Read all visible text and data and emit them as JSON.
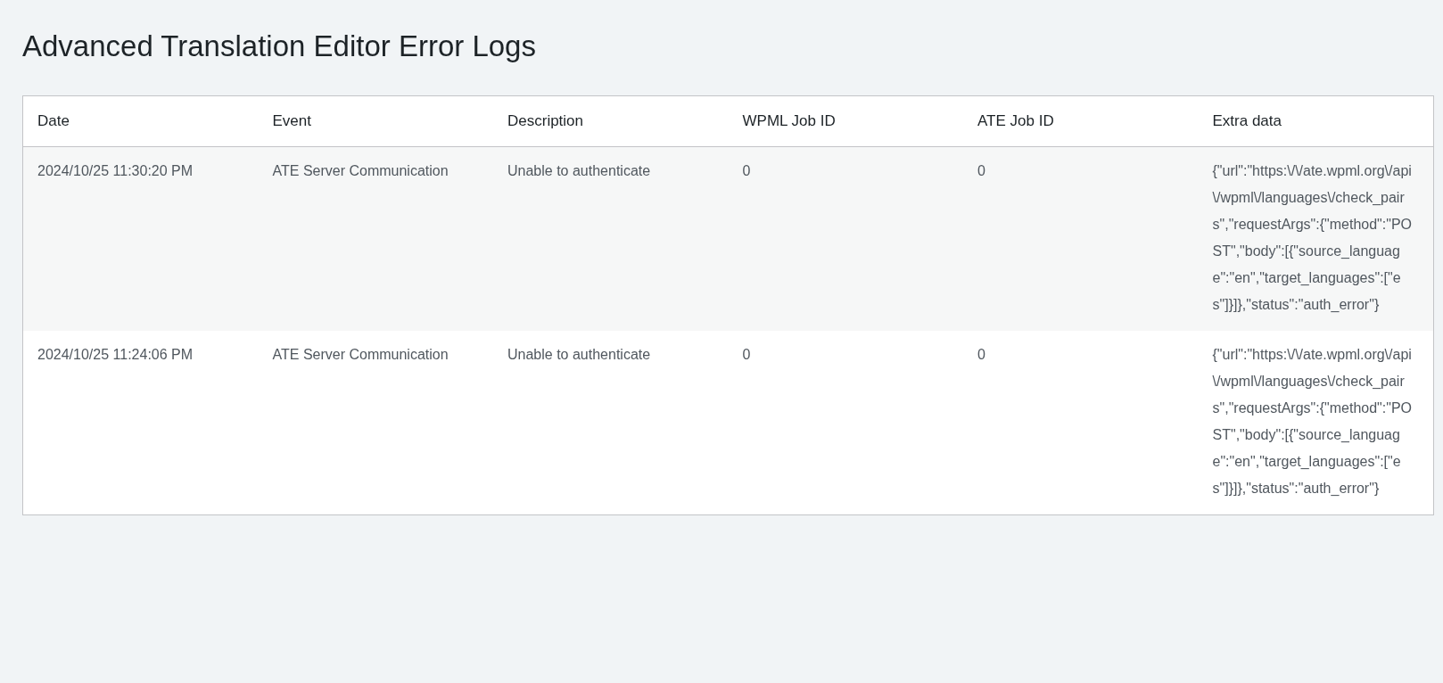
{
  "title": "Advanced Translation Editor Error Logs",
  "table": {
    "columns": [
      "Date",
      "Event",
      "Description",
      "WPML Job ID",
      "ATE Job ID",
      "Extra data"
    ],
    "rows": [
      {
        "cells": [
          "2024/10/25 11:30:20 PM",
          "ATE Server Communication",
          "Unable to authenticate",
          "0",
          "0",
          "{\"url\":\"https:\\/\\/ate.wpml.org\\/api\\/wpml\\/languages\\/check_pairs\",\"requestArgs\":{\"method\":\"POST\",\"body\":[{\"source_language\":\"en\",\"target_languages\":[\"es\"]}]},\"status\":\"auth_error\"}"
        ]
      },
      {
        "cells": [
          "2024/10/25 11:24:06 PM",
          "ATE Server Communication",
          "Unable to authenticate",
          "0",
          "0",
          "{\"url\":\"https:\\/\\/ate.wpml.org\\/api\\/wpml\\/languages\\/check_pairs\",\"requestArgs\":{\"method\":\"POST\",\"body\":[{\"source_language\":\"en\",\"target_languages\":[\"es\"]}]},\"status\":\"auth_error\"}"
        ]
      }
    ]
  }
}
